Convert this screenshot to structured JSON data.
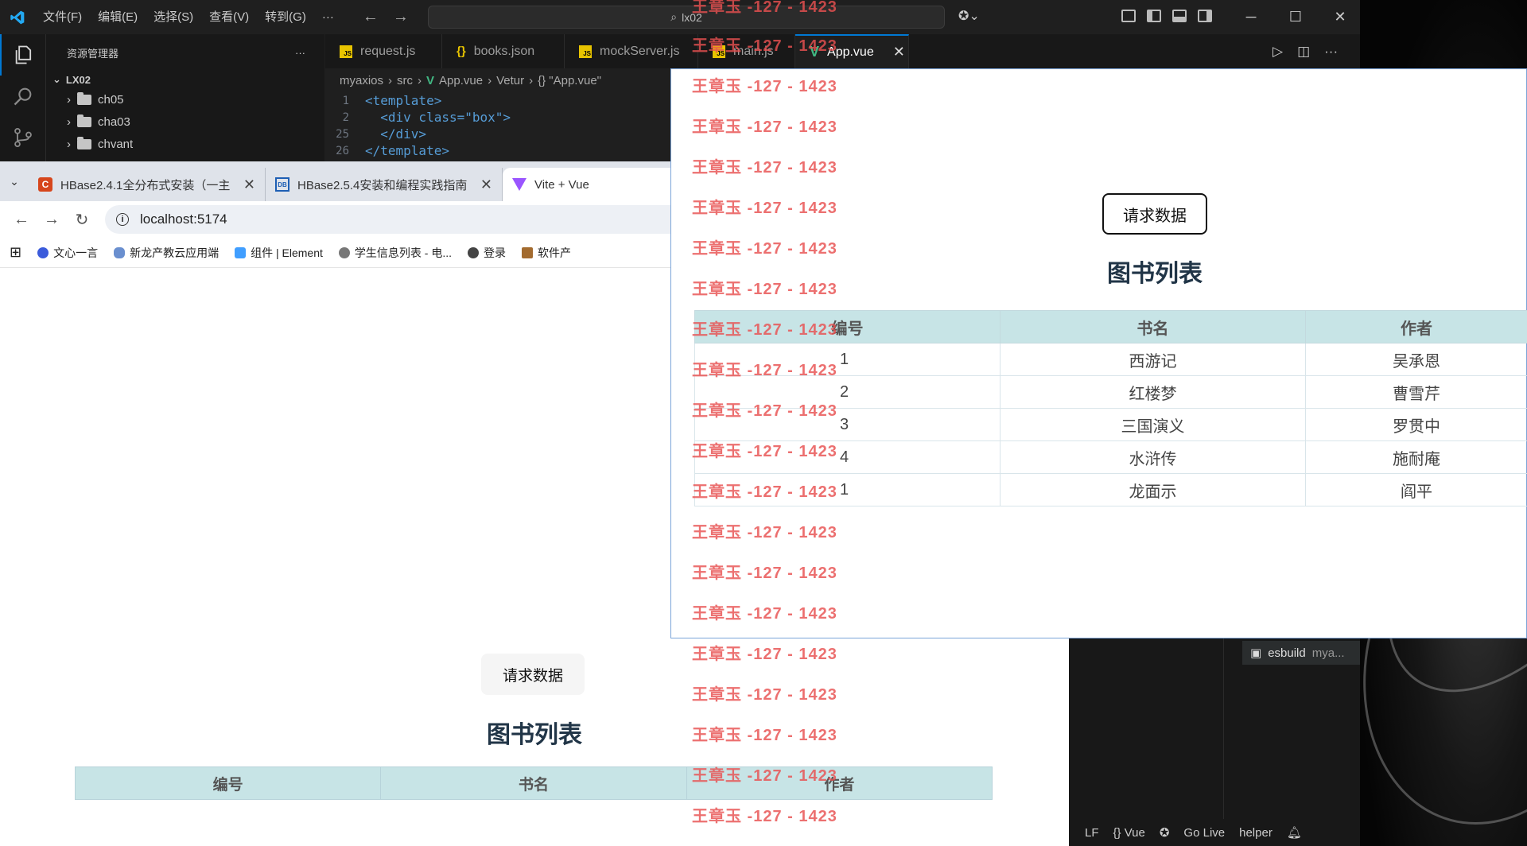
{
  "vscode": {
    "menu": [
      "文件(F)",
      "编辑(E)",
      "选择(S)",
      "查看(V)",
      "转到(G)",
      "···"
    ],
    "search_text": "lx02",
    "explorer_title": "资源管理器",
    "explorer_more": "···",
    "project": "LX02",
    "folders": [
      "ch05",
      "cha03",
      "chvant"
    ],
    "tabs": [
      {
        "label": "request.js",
        "icon": "js"
      },
      {
        "label": "books.json",
        "icon": "json"
      },
      {
        "label": "mockServer.js",
        "icon": "js"
      },
      {
        "label": "main.js",
        "icon": "js"
      },
      {
        "label": "App.vue",
        "icon": "vue",
        "active": true
      }
    ],
    "breadcrumb": [
      "myaxios",
      "src",
      "App.vue",
      "Vetur",
      "{} \"App.vue\""
    ],
    "code_lines": [
      {
        "n": "1",
        "text": "<template>"
      },
      {
        "n": "2",
        "text": "  <div class=\"box\">"
      },
      {
        "n": "25",
        "text": "  </div>"
      },
      {
        "n": "26",
        "text": "</template>"
      }
    ],
    "terminal_item": "esbuild",
    "terminal_item_sub": "mya...",
    "statusbar": [
      "LF",
      "{} Vue",
      "Go Live",
      "helper"
    ]
  },
  "browser": {
    "tabs": [
      {
        "title": "HBase2.4.1全分布式安装（一主",
        "icon": "csdn"
      },
      {
        "title": "HBase2.5.4安装和编程实践指南",
        "icon": "dblab"
      },
      {
        "title": "Vite + Vue",
        "icon": "vite",
        "active": true
      }
    ],
    "url": "localhost:5174",
    "bookmarks": [
      "文心一言",
      "新龙产教云应用端",
      "组件 | Element",
      "学生信息列表 - 电...",
      "登录",
      "软件产"
    ],
    "button_label": "请求数据",
    "heading": "图书列表",
    "headers": [
      "编号",
      "书名",
      "作者"
    ]
  },
  "app": {
    "button_label": "请求数据",
    "heading": "图书列表",
    "headers": [
      "编号",
      "书名",
      "作者"
    ],
    "rows": [
      [
        "1",
        "西游记",
        "吴承恩"
      ],
      [
        "2",
        "红楼梦",
        "曹雪芹"
      ],
      [
        "3",
        "三国演义",
        "罗贯中"
      ],
      [
        "4",
        "水浒传",
        "施耐庵"
      ],
      [
        "1",
        "龙面示",
        "阎平"
      ]
    ]
  },
  "watermark_text": "王章玉 -127 - 1423",
  "colors": {
    "vscode_bg": "#1f1f1f",
    "accent": "#0078d4",
    "table_header": "#c7e4e6",
    "watermark": "#e85050",
    "heading": "#213547"
  }
}
